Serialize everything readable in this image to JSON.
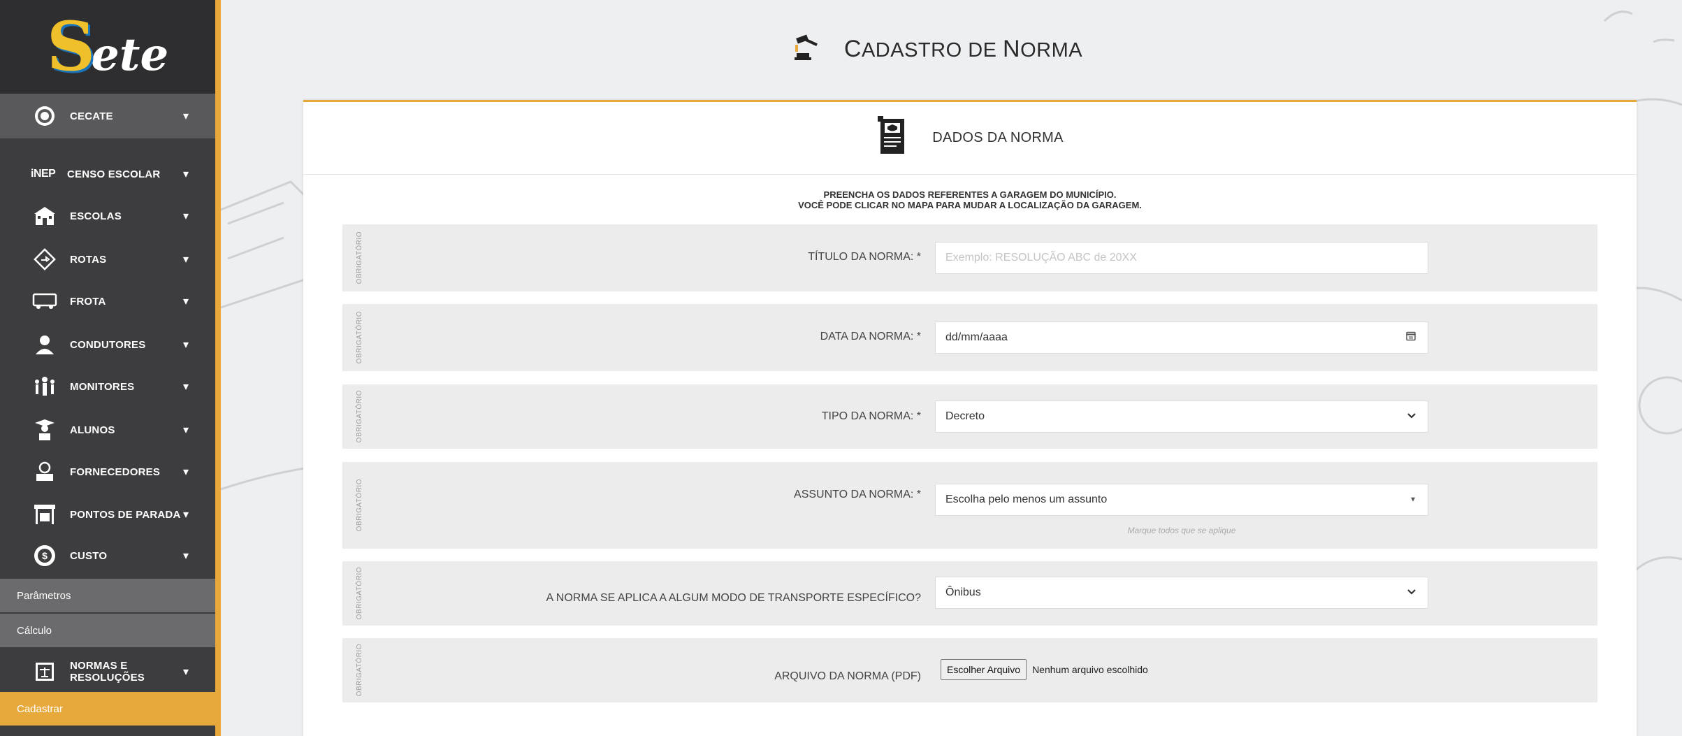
{
  "sidebar": {
    "logo": {
      "s": "S",
      "rest": "ete"
    },
    "cecate": "CECATE",
    "items": [
      {
        "label": "CENSO ESCOLAR",
        "icon": "inep-icon",
        "prefix": "iNEP"
      },
      {
        "label": "ESCOLAS",
        "icon": "school-icon"
      },
      {
        "label": "ROTAS",
        "icon": "route-icon"
      },
      {
        "label": "FROTA",
        "icon": "bus-icon"
      },
      {
        "label": "CONDUTORES",
        "icon": "driver-icon"
      },
      {
        "label": "MONITORES",
        "icon": "monitors-icon"
      },
      {
        "label": "ALUNOS",
        "icon": "student-icon"
      },
      {
        "label": "FORNECEDORES",
        "icon": "supplier-icon"
      },
      {
        "label": "PONTOS DE PARADA",
        "icon": "bus-stop-icon"
      },
      {
        "label": "CUSTO",
        "icon": "money-icon"
      }
    ],
    "custo_sub": [
      "Parâmetros",
      "Cálculo"
    ],
    "normas": "NORMAS E RESOLUÇÕES",
    "normas_sub": [
      "Cadastrar"
    ]
  },
  "header": {
    "title_c": "C",
    "title_rest1": "ADASTRO DE ",
    "title_n": "N",
    "title_rest2": "ORMA"
  },
  "card": {
    "title": "DADOS DA NORMA",
    "instructions_line1": "PREENCHA OS DADOS REFERENTES A GARAGEM DO MUNICÍPIO.",
    "instructions_line2": "VOCÊ PODE CLICAR NO MAPA PARA MUDAR A LOCALIZAÇÃO DA GARAGEM."
  },
  "form": {
    "required_tag": "OBRIGATÓRIO",
    "titulo": {
      "label": "TÍTULO DA NORMA: *",
      "placeholder": "Exemplo: RESOLUÇÃO ABC de 20XX"
    },
    "data": {
      "label": "DATA DA NORMA: *",
      "value": "dd/mm/aaaa"
    },
    "tipo": {
      "label": "TIPO DA NORMA: *",
      "value": "Decreto"
    },
    "assunto": {
      "label": "ASSUNTO DA NORMA: *",
      "value": "Escolha pelo menos um assunto",
      "hint": "Marque todos que se aplique"
    },
    "modo": {
      "label": "A NORMA SE APLICA A ALGUM MODO DE TRANSPORTE ESPECÍFICO?",
      "value": "Ônibus"
    },
    "arquivo": {
      "label": "ARQUIVO DA NORMA (PDF)",
      "button": "Escolher Arquivo",
      "status": "Nenhum arquivo escolhido"
    }
  },
  "colors": {
    "accent": "#e8a93c",
    "sidebar": "#3d3d3f"
  }
}
